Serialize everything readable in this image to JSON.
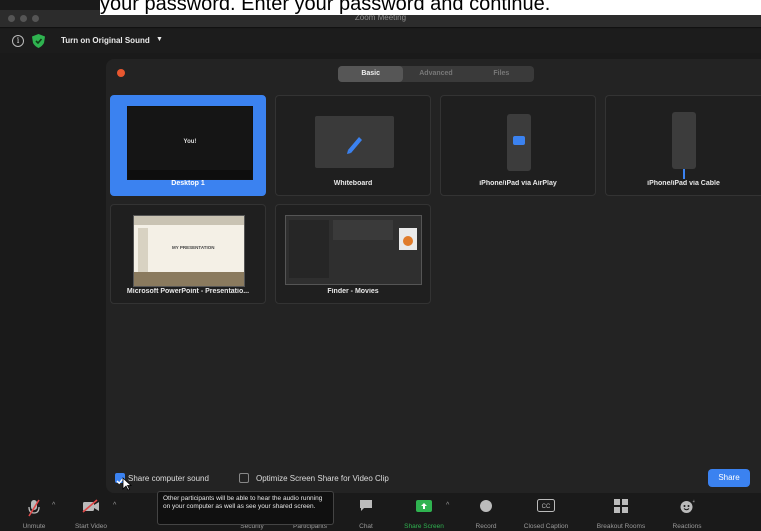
{
  "caption": "your password. Enter your password and continue.",
  "window": {
    "title": "Zoom Meeting"
  },
  "topbar": {
    "original_sound_label": "Turn on Original Sound"
  },
  "tabs": [
    {
      "label": "Basic",
      "active": true
    },
    {
      "label": "Advanced",
      "active": false
    },
    {
      "label": "Files",
      "active": false
    }
  ],
  "tiles": [
    {
      "label": "Desktop 1",
      "selected": true,
      "thumb_text": "You!"
    },
    {
      "label": "Whiteboard",
      "selected": false
    },
    {
      "label": "iPhone/iPad via AirPlay",
      "selected": false
    },
    {
      "label": "iPhone/iPad via Cable",
      "selected": false
    },
    {
      "label": "Microsoft PowerPoint - Presentatio...",
      "selected": false,
      "thumb_text": "MY PRESENTATION"
    },
    {
      "label": "Finder - Movies",
      "selected": false
    }
  ],
  "options": {
    "share_sound": {
      "label": "Share computer sound",
      "checked": true
    },
    "optimize_video": {
      "label": "Optimize Screen Share for Video Clip",
      "checked": false
    }
  },
  "share_button": "Share",
  "tooltip": "Other participants will be able to hear the audio running on your computer as well as see your shared screen.",
  "toolbar": [
    {
      "label": "Unmute",
      "icon": "muted-mic-icon"
    },
    {
      "label": "Start Video",
      "icon": "video-off-icon"
    },
    {
      "label": "Security",
      "icon": "shield-icon"
    },
    {
      "label": "Participants",
      "icon": "participants-icon"
    },
    {
      "label": "Chat",
      "icon": "chat-icon"
    },
    {
      "label": "Share Screen",
      "icon": "share-screen-icon"
    },
    {
      "label": "Record",
      "icon": "record-icon"
    },
    {
      "label": "Closed Caption",
      "icon": "cc-icon"
    },
    {
      "label": "Breakout Rooms",
      "icon": "breakout-rooms-icon"
    },
    {
      "label": "Reactions",
      "icon": "reactions-icon"
    }
  ],
  "colors": {
    "accent": "#3b82f0",
    "share_screen": "#2fb350",
    "close": "#e8572f"
  }
}
